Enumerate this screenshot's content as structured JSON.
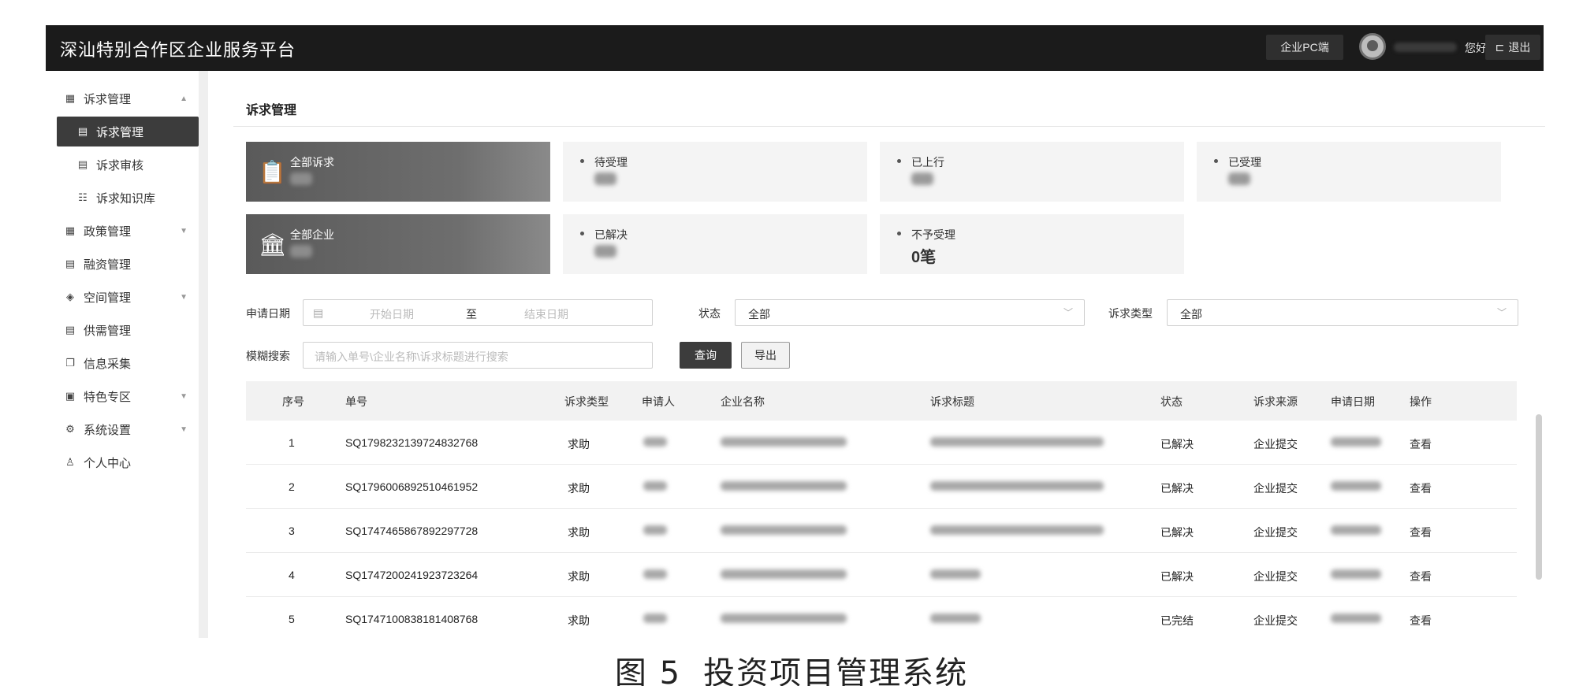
{
  "header": {
    "app_title": "深汕特别合作区企业服务平台",
    "pc_label": "企业PC端",
    "greeting": "您好!",
    "logout_label": "退出"
  },
  "sidebar": {
    "items": [
      {
        "label": "诉求管理",
        "icon": "grid-icon"
      },
      {
        "label": "诉求管理",
        "icon": "document-icon"
      },
      {
        "label": "诉求审核",
        "icon": "document-icon"
      },
      {
        "label": "诉求知识库",
        "icon": "list-icon"
      },
      {
        "label": "政策管理",
        "icon": "grid-icon"
      },
      {
        "label": "融资管理",
        "icon": "document-icon"
      },
      {
        "label": "空间管理",
        "icon": "layers-icon"
      },
      {
        "label": "供需管理",
        "icon": "document-icon"
      },
      {
        "label": "信息采集",
        "icon": "copy-icon"
      },
      {
        "label": "特色专区",
        "icon": "calendar-icon"
      },
      {
        "label": "系统设置",
        "icon": "gear-icon"
      },
      {
        "label": "个人中心",
        "icon": "user-icon"
      }
    ]
  },
  "main": {
    "title": "诉求管理",
    "cards": {
      "all_requests": "全部诉求",
      "pending": "待受理",
      "escalated": "已上行",
      "accepted": "已受理",
      "all_companies": "全部企业",
      "resolved": "已解决",
      "rejected": "不予受理",
      "rejected_value": "0笔"
    },
    "filters": {
      "date_label": "申请日期",
      "start_placeholder": "开始日期",
      "to": "至",
      "end_placeholder": "结束日期",
      "status_label": "状态",
      "status_value": "全部",
      "type_label": "诉求类型",
      "type_value": "全部",
      "search_label": "模糊搜索",
      "search_placeholder": "请输入单号\\企业名称\\诉求标题进行搜索",
      "query_label": "查询",
      "export_label": "导出"
    },
    "table": {
      "columns": [
        "序号",
        "单号",
        "诉求类型",
        "申请人",
        "企业名称",
        "诉求标题",
        "状态",
        "诉求来源",
        "申请日期",
        "操作"
      ],
      "rows": [
        {
          "no": "1",
          "id": "SQ1798232139724832768",
          "type": "求助",
          "status": "已解决",
          "source": "企业提交",
          "action": "查看"
        },
        {
          "no": "2",
          "id": "SQ1796006892510461952",
          "type": "求助",
          "status": "已解决",
          "source": "企业提交",
          "action": "查看"
        },
        {
          "no": "3",
          "id": "SQ1747465867892297728",
          "type": "求助",
          "status": "已解决",
          "source": "企业提交",
          "action": "查看"
        },
        {
          "no": "4",
          "id": "SQ1747200241923723264",
          "type": "求助",
          "status": "已解决",
          "source": "企业提交",
          "action": "查看"
        },
        {
          "no": "5",
          "id": "SQ1747100838181408768",
          "type": "求助",
          "status": "已完结",
          "source": "企业提交",
          "action": "查看"
        }
      ]
    }
  },
  "caption": {
    "number": "图 5",
    "text": "投资项目管理系统"
  }
}
